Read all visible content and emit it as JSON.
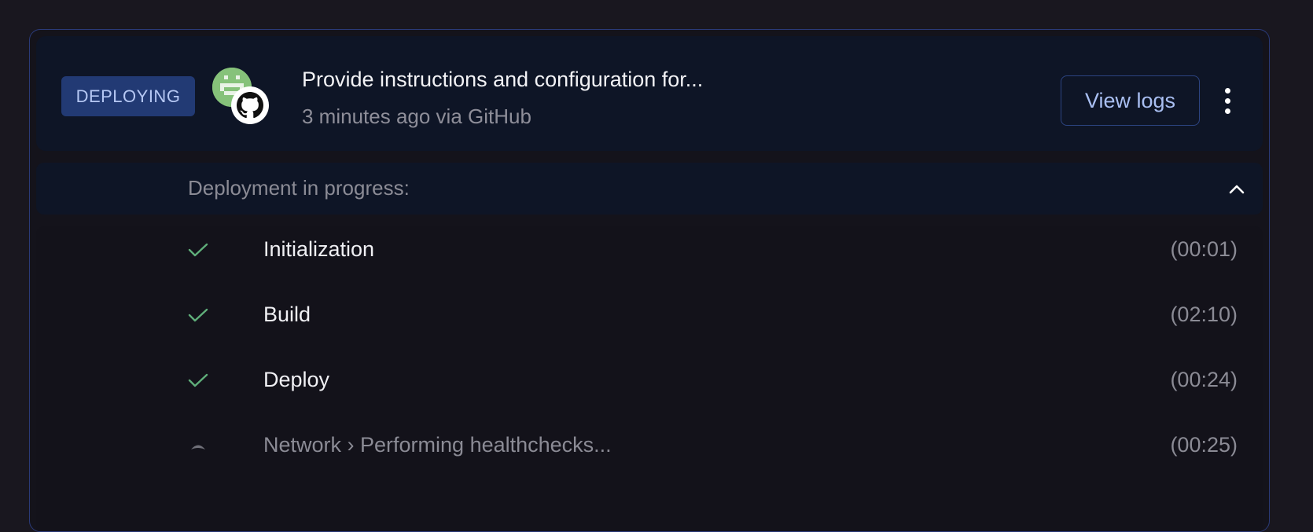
{
  "colors": {
    "background": "#19171f",
    "card_border": "#2a3a78",
    "header_bg": "#0e1526",
    "badge_bg": "#223a74",
    "badge_text": "#b6c8f4",
    "check": "#5fae7a",
    "button_text": "#a9bff2"
  },
  "deployment": {
    "status": "DEPLOYING",
    "title": "Provide instructions and configuration for...",
    "subtitle": "3 minutes ago via GitHub",
    "view_logs_label": "View logs",
    "avatar_icon": "identicon-avatar",
    "source_icon": "github-icon",
    "menu_icon": "kebab-menu-icon"
  },
  "progress": {
    "label": "Deployment in progress:",
    "toggle_icon": "chevron-up-icon"
  },
  "steps": [
    {
      "label": "Initialization",
      "time": "(00:01)",
      "state": "done",
      "icon": "check-icon"
    },
    {
      "label": "Build",
      "time": "(02:10)",
      "state": "done",
      "icon": "check-icon"
    },
    {
      "label": "Deploy",
      "time": "(00:24)",
      "state": "done",
      "icon": "check-icon"
    },
    {
      "label": "Network › Performing healthchecks...",
      "time": "(00:25)",
      "state": "in-progress",
      "icon": "spinner-icon"
    }
  ]
}
